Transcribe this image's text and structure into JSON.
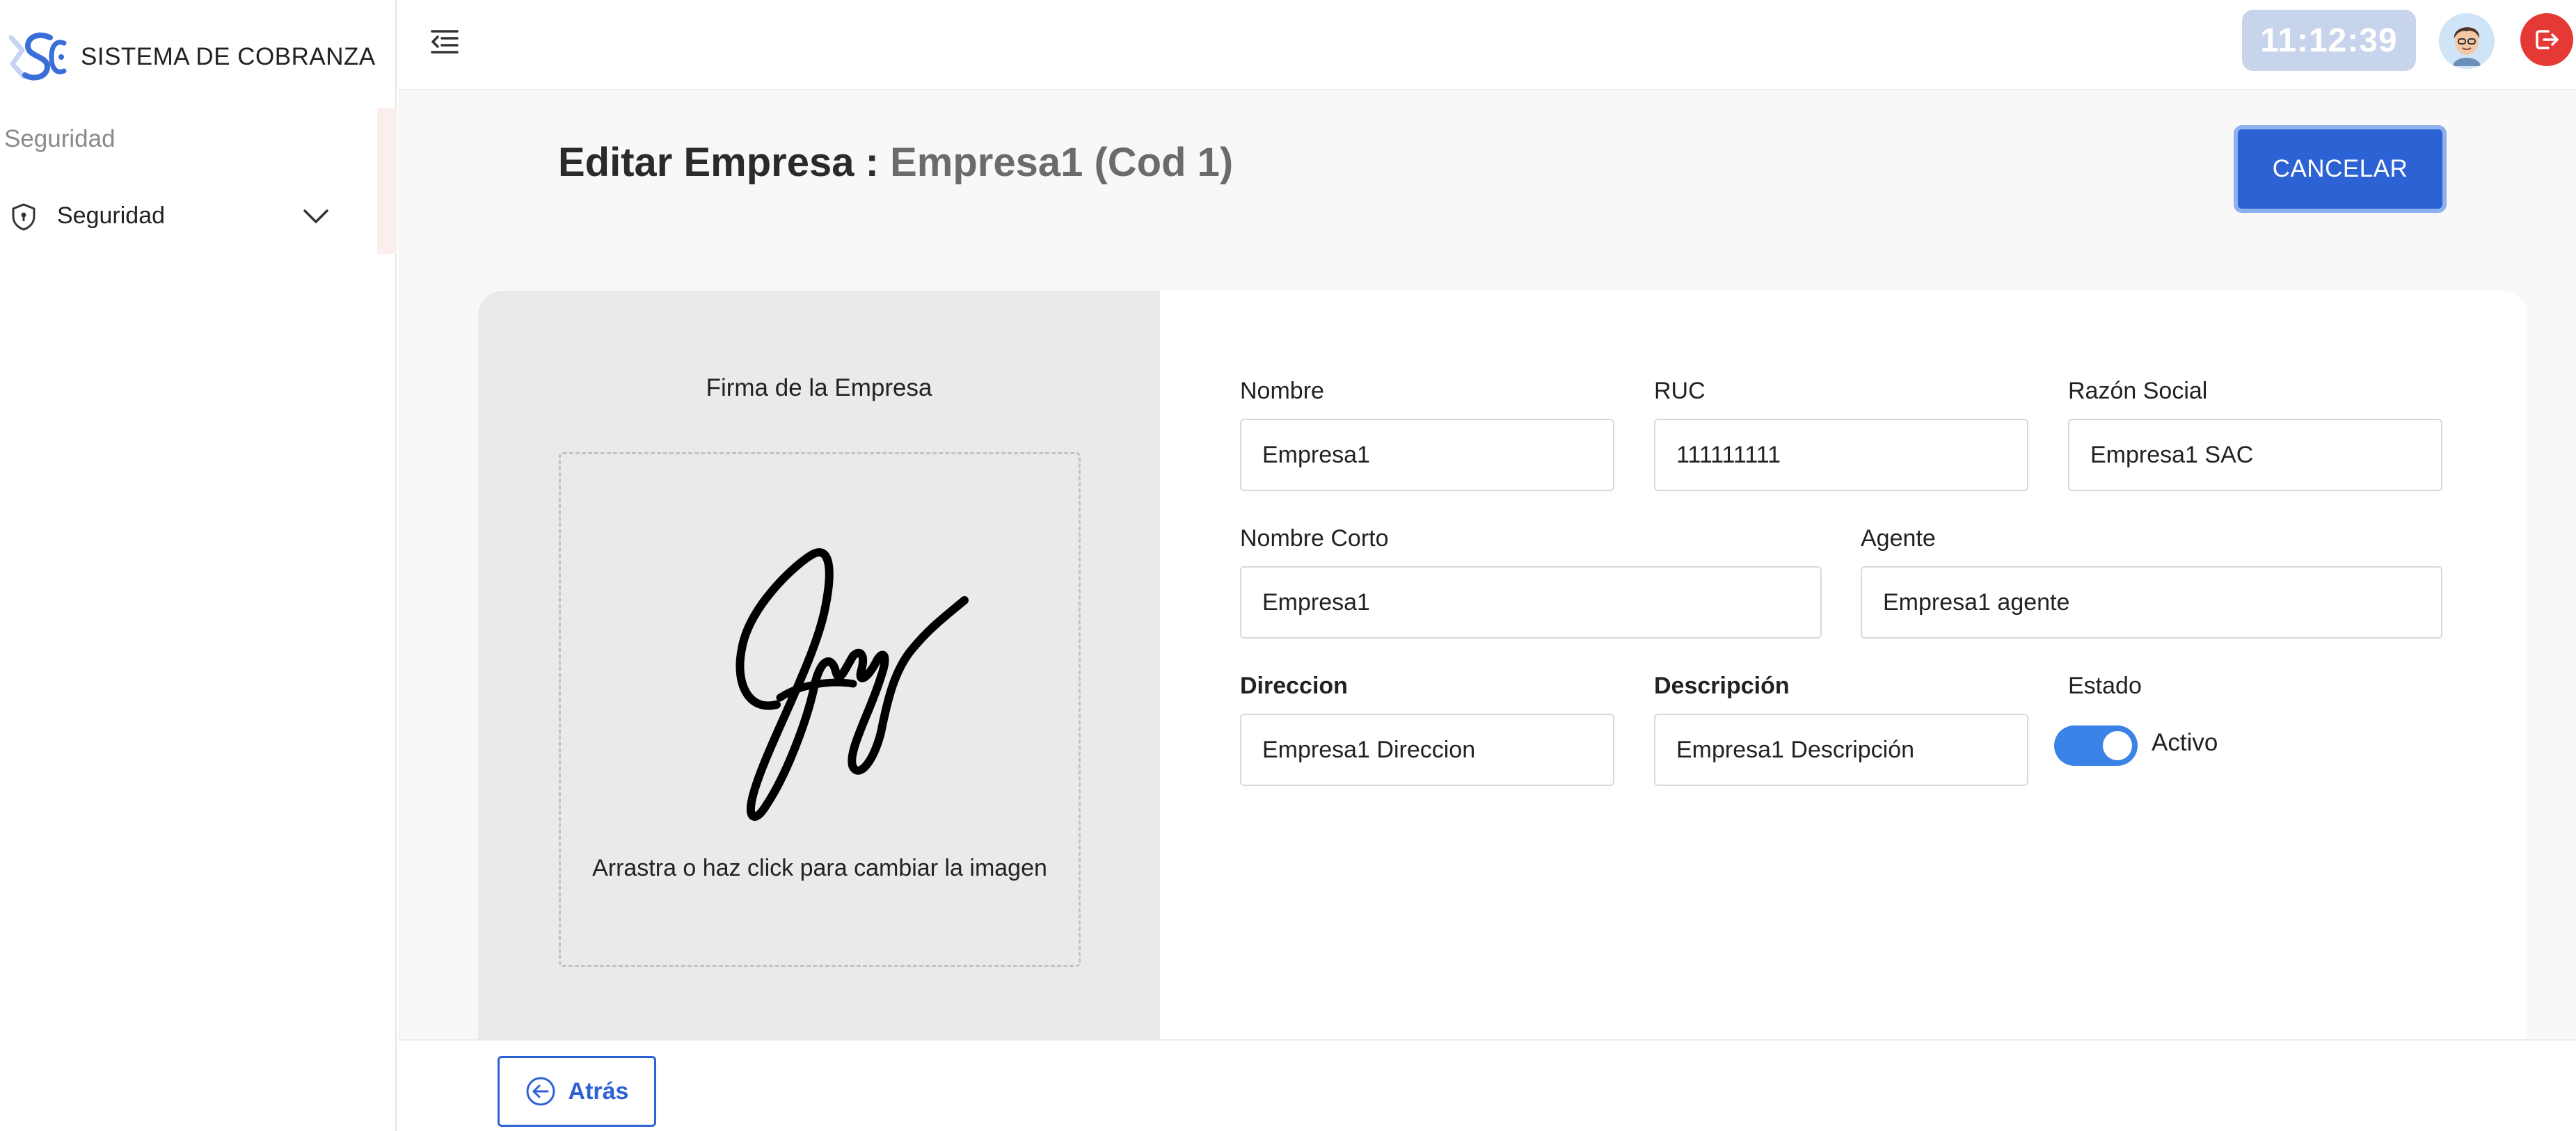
{
  "app": {
    "brand_name": "SISTEMA DE COBRANZA",
    "logo_icon": "sc-logo-icon",
    "accent_color": "#2d62d4"
  },
  "sidebar": {
    "section_title": "Seguridad",
    "items": [
      {
        "label": "Seguridad",
        "icon": "shield-icon",
        "expand_icon": "chevron-down-icon"
      }
    ]
  },
  "topbar": {
    "menu_icon": "menu-collapse-icon",
    "clock": "11:12:39",
    "avatar_icon": "user-avatar",
    "logout_icon": "logout-icon",
    "logout_color": "#e53935"
  },
  "page": {
    "title": "Editar Empresa : ",
    "subtitle": "Empresa1 (Cod 1)",
    "cancel_label": "CANCELAR"
  },
  "signature": {
    "title": "Firma de la Empresa",
    "dropzone_text": "Arrastra o haz click para cambiar la imagen"
  },
  "form": {
    "nombre": {
      "label": "Nombre",
      "value": "Empresa1"
    },
    "ruc": {
      "label": "RUC",
      "value": "111111111"
    },
    "razon_social": {
      "label": "Razón Social",
      "value": "Empresa1 SAC"
    },
    "nombre_corto": {
      "label": "Nombre Corto",
      "value": "Empresa1"
    },
    "agente": {
      "label": "Agente",
      "value": "Empresa1 agente"
    },
    "direccion": {
      "label": "Direccion",
      "value": "Empresa1 Direccion"
    },
    "descripcion": {
      "label": "Descripción",
      "value": "Empresa1 Descripción"
    },
    "estado": {
      "label": "Estado",
      "value": "Activo",
      "enabled": true
    }
  },
  "footer": {
    "back_label": "Atrás",
    "back_icon": "arrow-left-circle-icon"
  }
}
